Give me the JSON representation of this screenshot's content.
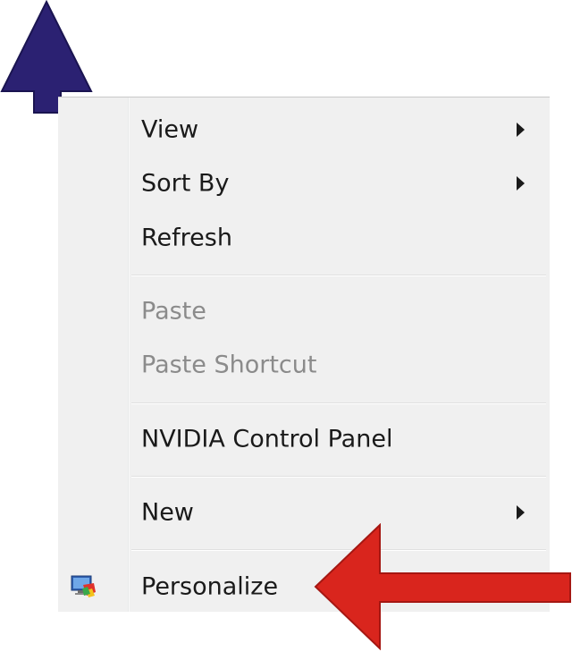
{
  "context_menu": {
    "items": [
      {
        "label": "View",
        "disabled": false,
        "has_submenu": true
      },
      {
        "label": "Sort By",
        "disabled": false,
        "has_submenu": true
      },
      {
        "label": "Refresh",
        "disabled": false,
        "has_submenu": false
      },
      {
        "label": "Paste",
        "disabled": true,
        "has_submenu": false
      },
      {
        "label": "Paste Shortcut",
        "disabled": true,
        "has_submenu": false
      },
      {
        "label": "NVIDIA Control Panel",
        "disabled": false,
        "has_submenu": false
      },
      {
        "label": "New",
        "disabled": false,
        "has_submenu": true
      },
      {
        "label": "Personalize",
        "disabled": false,
        "has_submenu": false,
        "icon": "personalize-icon"
      }
    ]
  },
  "annotations": {
    "up_arrow_color": "#2b2172",
    "left_arrow_color": "#d9251d",
    "up_arrow_icon": "arrow-up-icon",
    "left_arrow_icon": "arrow-left-icon"
  },
  "colors": {
    "menu_background": "#f0f0f0",
    "text": "#1a1a1a",
    "disabled_text": "#8b8b8b"
  }
}
